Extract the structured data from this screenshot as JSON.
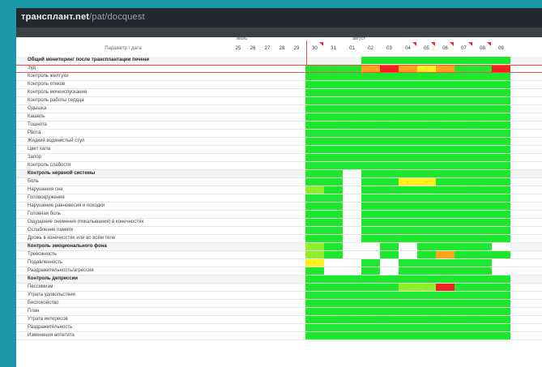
{
  "app": {
    "brand": "трансплант.net",
    "path": "/pat/docquest"
  },
  "table": {
    "title": "Параметр \\ дата",
    "months": [
      {
        "key": "july",
        "label": "июль"
      },
      {
        "key": "august",
        "label": "август"
      }
    ],
    "dates": [
      "25",
      "26",
      "27",
      "28",
      "29",
      "30",
      "31",
      "01",
      "02",
      "03",
      "04",
      "05",
      "06",
      "07",
      "08",
      "09"
    ],
    "flagged_dates": [
      5,
      10,
      11,
      12,
      13,
      14
    ],
    "rows": [
      {
        "label": "Общий мониторинг после трансплантации печени",
        "header": true,
        "cells": "........gggggggg"
      },
      {
        "label": "Зуд",
        "cells": ".....gggoroyoggr"
      },
      {
        "label": "Контроль желтухи",
        "cells": ".....ggggggggggg"
      },
      {
        "label": "Контроль отеков",
        "cells": ".....ggggggggggg"
      },
      {
        "label": "Контроль мочеиспускания",
        "cells": ".....ggggggggggg"
      },
      {
        "label": "Контроль работы сердца",
        "cells": ".....ggggggggggg"
      },
      {
        "label": "Одышка",
        "cells": ".....ggggggggggg"
      },
      {
        "label": "Кашель",
        "cells": ".....ggggggggggg"
      },
      {
        "label": "Тошнота",
        "cells": ".....ggggggggggg"
      },
      {
        "label": "Рвота",
        "cells": ".....ggggggggggg"
      },
      {
        "label": "Жидкий водянистый стул",
        "cells": ".....ggggggggggg"
      },
      {
        "label": "Цвет кала",
        "cells": ".....ggggggggggg"
      },
      {
        "label": "Запор",
        "cells": ".....ggggggggggg"
      },
      {
        "label": "Контроль слабости",
        "cells": ".....ggggggggggg"
      },
      {
        "label": "Контроль нервной системы",
        "header": true,
        "cells": ".....ggwgggggggg"
      },
      {
        "label": "Боль",
        "cells": ".....ggwggyyggggy"
      },
      {
        "label": "Нарушения сна",
        "cells": ".....lgwggggggggg"
      },
      {
        "label": "Головокружения",
        "cells": ".....ggwggggggggg"
      },
      {
        "label": "Нарушение равновесия и походки",
        "cells": ".....ggwggggggggg"
      },
      {
        "label": "Головная боль",
        "cells": ".....ggwggggggggg"
      },
      {
        "label": "Ощущение онемения (покалывания) в конечностях",
        "cells": ".....ggwggggggggg"
      },
      {
        "label": "Ослабление памяти",
        "cells": ".....ggwggggggggg"
      },
      {
        "label": "Дрожь в конечностях или во всём теле",
        "cells": ".....ggwggggggggg"
      },
      {
        "label": "Контроль эмоционального фона",
        "header": true,
        "cells": ".....lgwwgwggggwgg"
      },
      {
        "label": "Тревожность",
        "cells": ".....lgwwgwgogggwo"
      },
      {
        "label": "Подавленность",
        "cells": ".....ywwgwgggggwg"
      },
      {
        "label": "Раздражительность/агрессия",
        "cells": ".....gwwgwgggggwg"
      },
      {
        "label": "Контроль депрессии",
        "header": true,
        "cells": ".....ggggggggggg"
      },
      {
        "label": "Пессимизм",
        "cells": ".....gggggllrggggl"
      },
      {
        "label": "Утрата удовольствия",
        "cells": ".....ggggggggggg"
      },
      {
        "label": "Беспокойство",
        "cells": ".....ggggggggggg"
      },
      {
        "label": "План",
        "cells": ".....ggggggggggg"
      },
      {
        "label": "Утрата интересов",
        "cells": ".....ggggggggggg"
      },
      {
        "label": "Раздражительность",
        "cells": ".....ggggggggggg"
      },
      {
        "label": "Изменения аппетита",
        "cells": ".....ggggggggggg"
      }
    ]
  },
  "colors": {
    "green": "#1ee82e",
    "light_green": "#8fef2a",
    "yellow": "#ffef1a",
    "orange": "#ffa41a",
    "red": "#f22020",
    "background": "#1a9aa8",
    "topbar": "#22282e"
  },
  "icons": {
    "flag": "red-corner-flag-icon",
    "cell_marker": "dash-marker-icon"
  }
}
